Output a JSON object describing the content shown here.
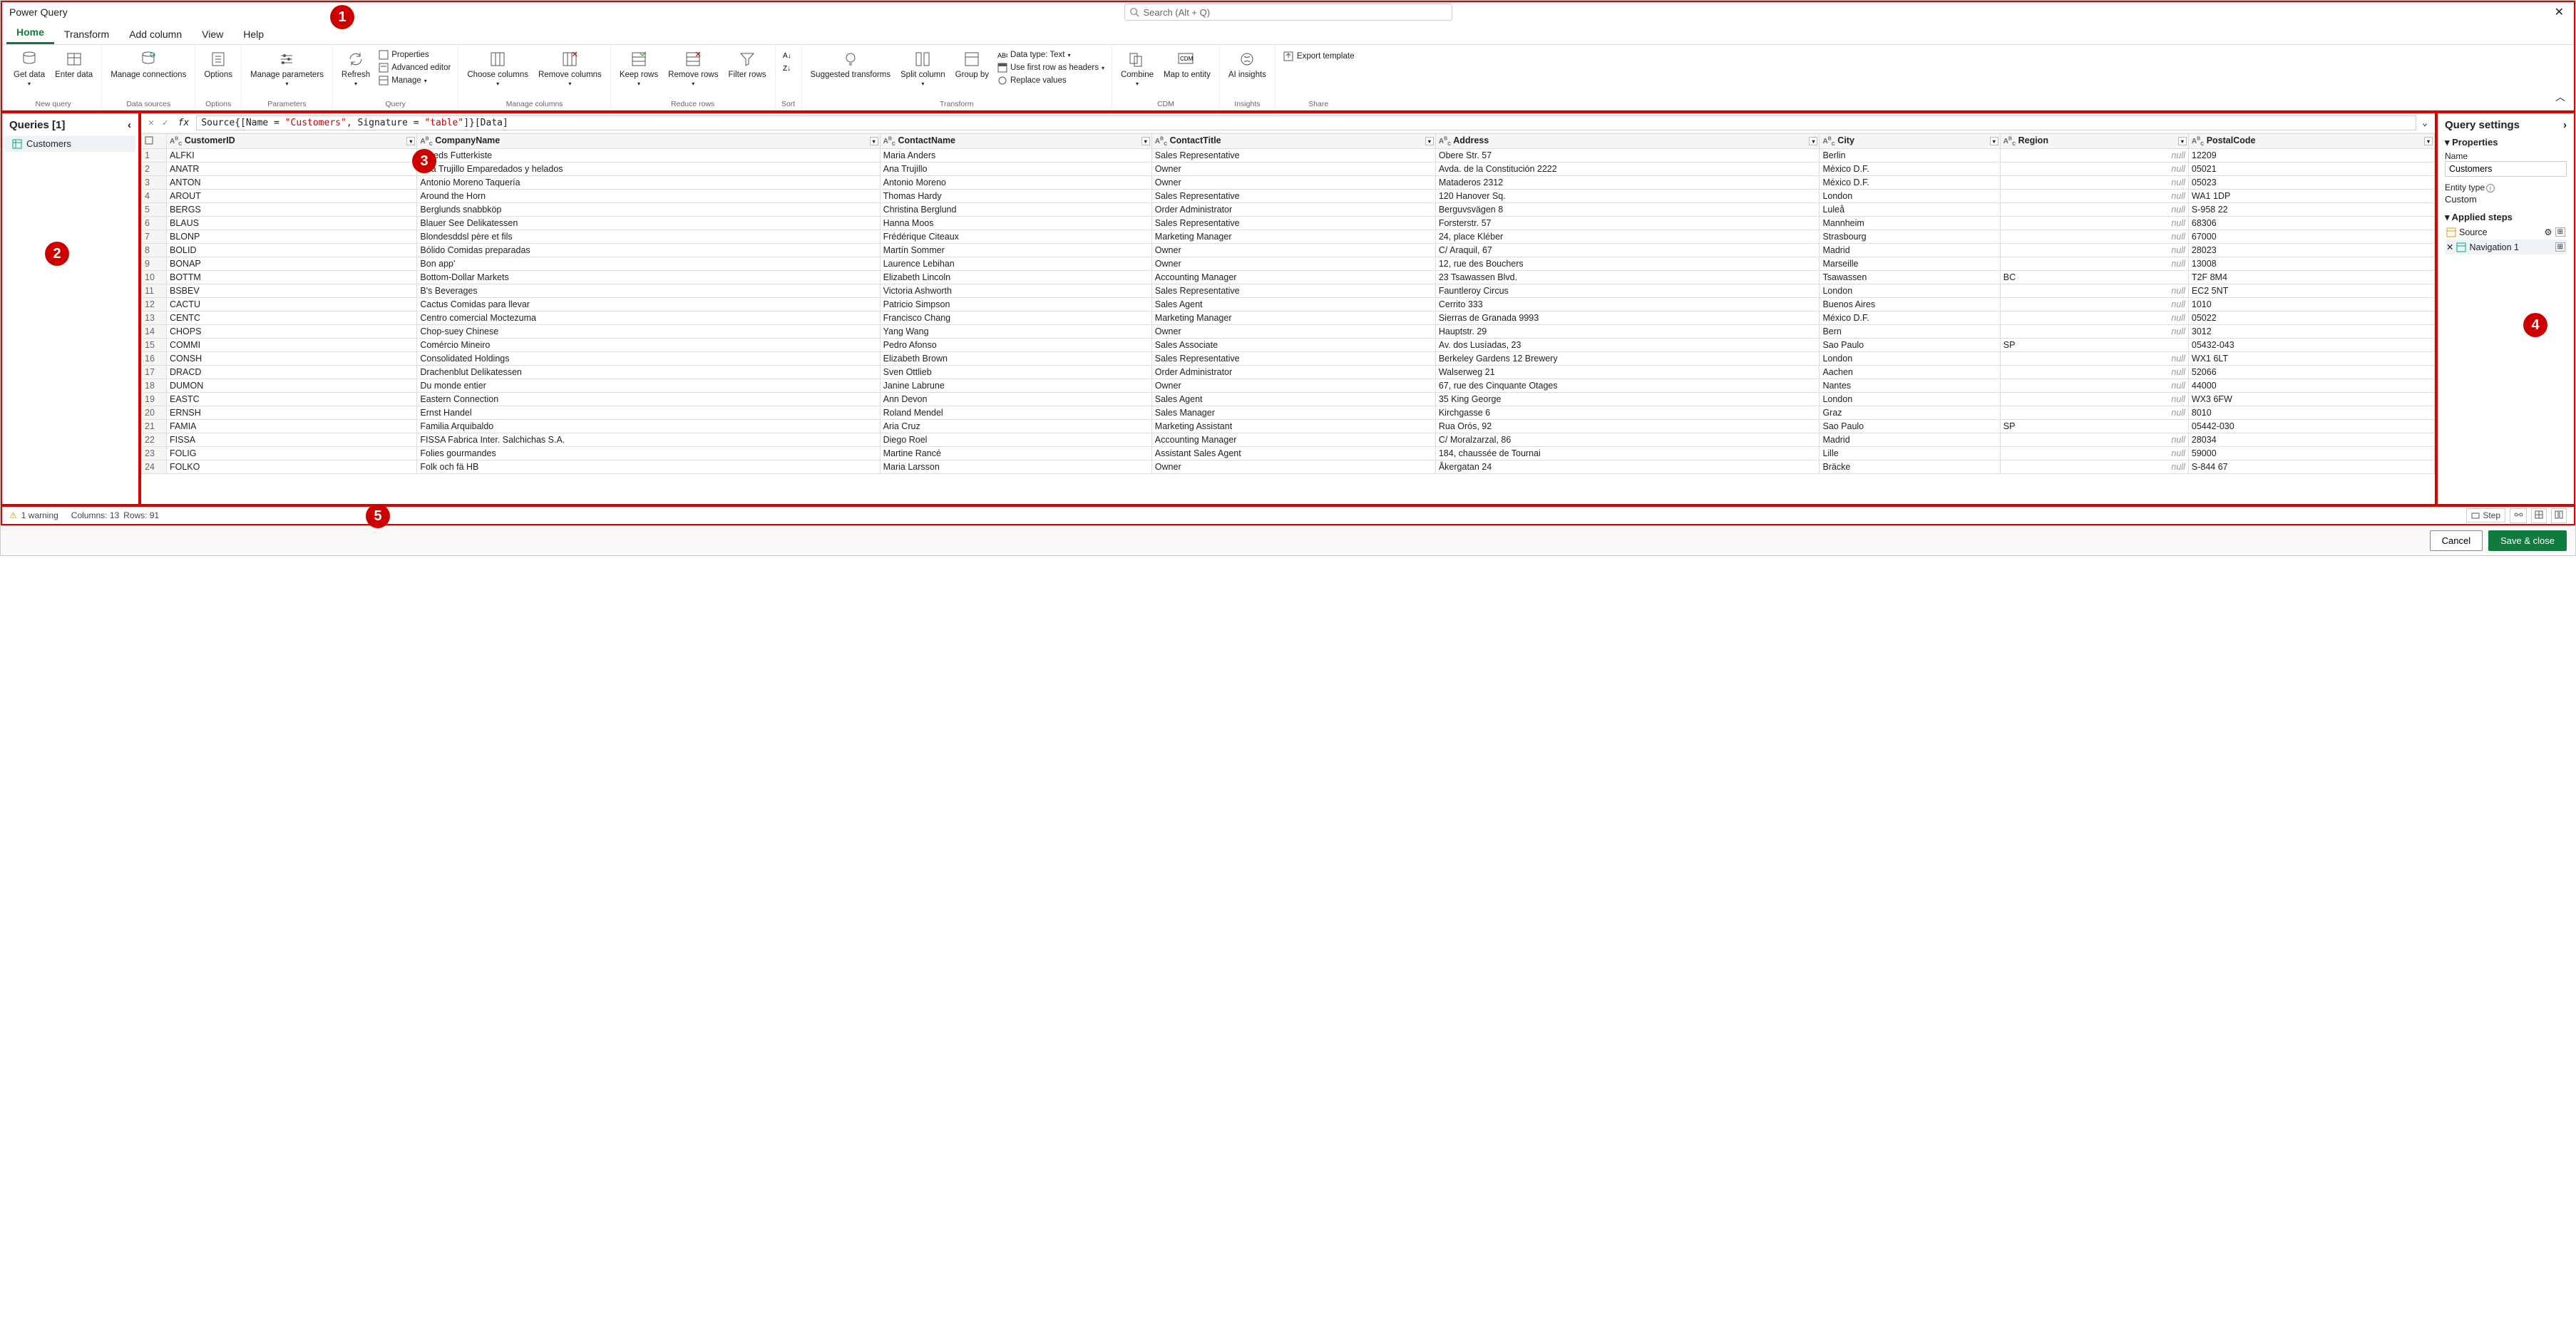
{
  "window_title": "Power Query",
  "search_placeholder": "Search (Alt + Q)",
  "tabs": [
    "Home",
    "Transform",
    "Add column",
    "View",
    "Help"
  ],
  "ribbon": {
    "groups": [
      {
        "label": "New query",
        "items": [
          "Get data",
          "Enter data"
        ]
      },
      {
        "label": "Data sources",
        "items": [
          "Manage connections"
        ]
      },
      {
        "label": "Options",
        "items": [
          "Options"
        ]
      },
      {
        "label": "Parameters",
        "items": [
          "Manage parameters"
        ]
      },
      {
        "label": "Query",
        "items": [
          "Refresh"
        ],
        "small": [
          "Properties",
          "Advanced editor",
          "Manage"
        ]
      },
      {
        "label": "Manage columns",
        "items": [
          "Choose columns",
          "Remove columns"
        ]
      },
      {
        "label": "Reduce rows",
        "items": [
          "Keep rows",
          "Remove rows",
          "Filter rows"
        ]
      },
      {
        "label": "Sort",
        "items": []
      },
      {
        "label": "Transform",
        "items": [
          "Suggested transforms",
          "Split column",
          "Group by"
        ],
        "small": [
          "Data type: Text",
          "Use first row as headers",
          "Replace values"
        ]
      },
      {
        "label": "CDM",
        "items": [
          "Combine",
          "Map to entity"
        ]
      },
      {
        "label": "Insights",
        "items": [
          "AI insights"
        ]
      },
      {
        "label": "Share",
        "items": [
          "Export template"
        ]
      }
    ]
  },
  "queries_header": "Queries [1]",
  "queries": [
    "Customers"
  ],
  "formula": {
    "prefix": "Source{[Name = ",
    "v1": "\"Customers\"",
    "mid": ", Signature = ",
    "v2": "\"table\"",
    "suffix": "]}[Data]"
  },
  "columns": [
    "CustomerID",
    "CompanyName",
    "ContactName",
    "ContactTitle",
    "Address",
    "City",
    "Region",
    "PostalCode"
  ],
  "rows": [
    [
      "ALFKI",
      "Alfreds Futterkiste",
      "Maria Anders",
      "Sales Representative",
      "Obere Str. 57",
      "Berlin",
      null,
      "12209"
    ],
    [
      "ANATR",
      "Ana Trujillo Emparedados y helados",
      "Ana Trujillo",
      "Owner",
      "Avda. de la Constitución 2222",
      "México D.F.",
      null,
      "05021"
    ],
    [
      "ANTON",
      "Antonio Moreno Taquería",
      "Antonio Moreno",
      "Owner",
      "Mataderos  2312",
      "México D.F.",
      null,
      "05023"
    ],
    [
      "AROUT",
      "Around the Horn",
      "Thomas Hardy",
      "Sales Representative",
      "120 Hanover Sq.",
      "London",
      null,
      "WA1 1DP"
    ],
    [
      "BERGS",
      "Berglunds snabbköp",
      "Christina Berglund",
      "Order Administrator",
      "Berguvsvägen  8",
      "Luleå",
      null,
      "S-958 22"
    ],
    [
      "BLAUS",
      "Blauer See Delikatessen",
      "Hanna Moos",
      "Sales Representative",
      "Forsterstr. 57",
      "Mannheim",
      null,
      "68306"
    ],
    [
      "BLONP",
      "Blondesddsl père et fils",
      "Frédérique Citeaux",
      "Marketing Manager",
      "24, place Kléber",
      "Strasbourg",
      null,
      "67000"
    ],
    [
      "BOLID",
      "Bólido Comidas preparadas",
      "Martín Sommer",
      "Owner",
      "C/ Araquil, 67",
      "Madrid",
      null,
      "28023"
    ],
    [
      "BONAP",
      "Bon app'",
      "Laurence Lebihan",
      "Owner",
      "12, rue des Bouchers",
      "Marseille",
      null,
      "13008"
    ],
    [
      "BOTTM",
      "Bottom-Dollar Markets",
      "Elizabeth Lincoln",
      "Accounting Manager",
      "23 Tsawassen Blvd.",
      "Tsawassen",
      "BC",
      "T2F 8M4"
    ],
    [
      "BSBEV",
      "B's Beverages",
      "Victoria Ashworth",
      "Sales Representative",
      "Fauntleroy Circus",
      "London",
      null,
      "EC2 5NT"
    ],
    [
      "CACTU",
      "Cactus Comidas para llevar",
      "Patricio Simpson",
      "Sales Agent",
      "Cerrito 333",
      "Buenos Aires",
      null,
      "1010"
    ],
    [
      "CENTC",
      "Centro comercial Moctezuma",
      "Francisco Chang",
      "Marketing Manager",
      "Sierras de Granada 9993",
      "México D.F.",
      null,
      "05022"
    ],
    [
      "CHOPS",
      "Chop-suey Chinese",
      "Yang Wang",
      "Owner",
      "Hauptstr. 29",
      "Bern",
      null,
      "3012"
    ],
    [
      "COMMI",
      "Comércio Mineiro",
      "Pedro Afonso",
      "Sales Associate",
      "Av. dos Lusíadas, 23",
      "Sao Paulo",
      "SP",
      "05432-043"
    ],
    [
      "CONSH",
      "Consolidated Holdings",
      "Elizabeth Brown",
      "Sales Representative",
      "Berkeley Gardens 12  Brewery",
      "London",
      null,
      "WX1 6LT"
    ],
    [
      "DRACD",
      "Drachenblut Delikatessen",
      "Sven Ottlieb",
      "Order Administrator",
      "Walserweg 21",
      "Aachen",
      null,
      "52066"
    ],
    [
      "DUMON",
      "Du monde entier",
      "Janine Labrune",
      "Owner",
      "67, rue des Cinquante Otages",
      "Nantes",
      null,
      "44000"
    ],
    [
      "EASTC",
      "Eastern Connection",
      "Ann Devon",
      "Sales Agent",
      "35 King George",
      "London",
      null,
      "WX3 6FW"
    ],
    [
      "ERNSH",
      "Ernst Handel",
      "Roland Mendel",
      "Sales Manager",
      "Kirchgasse 6",
      "Graz",
      null,
      "8010"
    ],
    [
      "FAMIA",
      "Familia Arquibaldo",
      "Aria Cruz",
      "Marketing Assistant",
      "Rua Orós, 92",
      "Sao Paulo",
      "SP",
      "05442-030"
    ],
    [
      "FISSA",
      "FISSA Fabrica Inter. Salchichas S.A.",
      "Diego Roel",
      "Accounting Manager",
      "C/ Moralzarzal, 86",
      "Madrid",
      null,
      "28034"
    ],
    [
      "FOLIG",
      "Folies gourmandes",
      "Martine Rancé",
      "Assistant Sales Agent",
      "184, chaussée de Tournai",
      "Lille",
      null,
      "59000"
    ],
    [
      "FOLKO",
      "Folk och fä HB",
      "Maria Larsson",
      "Owner",
      "Åkergatan 24",
      "Bräcke",
      null,
      "S-844 67"
    ]
  ],
  "settings": {
    "title": "Query settings",
    "properties_label": "Properties",
    "name_label": "Name",
    "name_value": "Customers",
    "entity_type_label": "Entity type",
    "entity_type_value": "Custom",
    "applied_steps_label": "Applied steps",
    "steps": [
      "Source",
      "Navigation 1"
    ]
  },
  "status": {
    "warning": "1 warning",
    "columns": "Columns: 13",
    "rows": "Rows: 91",
    "step_label": "Step"
  },
  "footer": {
    "cancel": "Cancel",
    "save": "Save & close"
  },
  "badges": [
    "1",
    "2",
    "3",
    "4",
    "5"
  ]
}
